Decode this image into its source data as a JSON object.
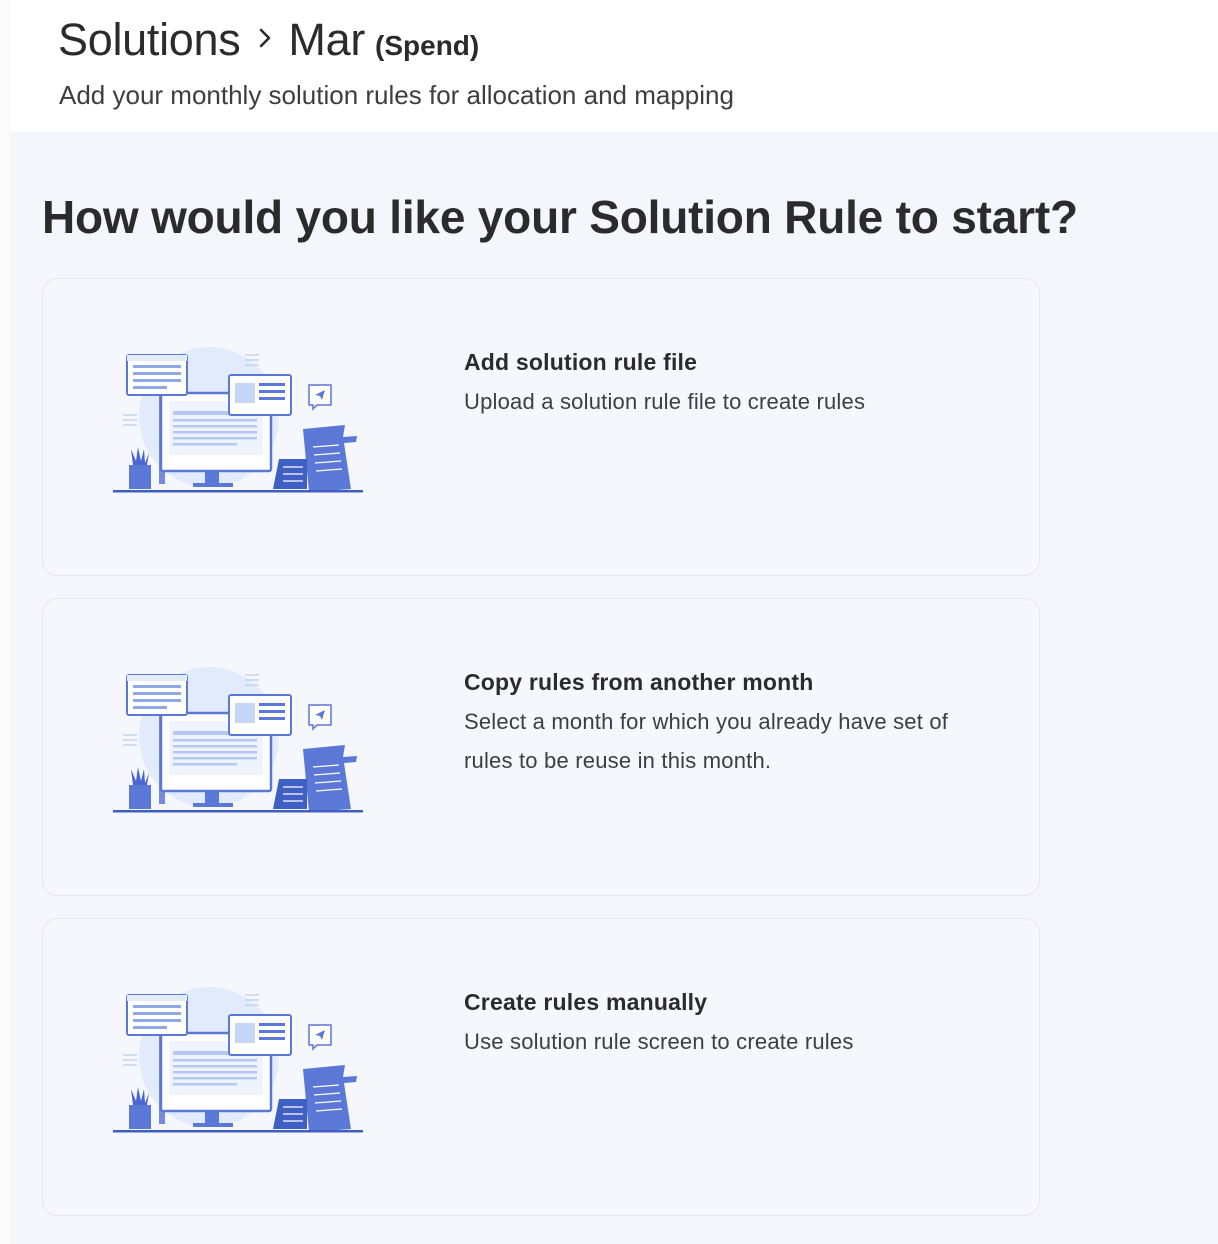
{
  "header": {
    "breadcrumb": {
      "root": "Solutions",
      "separator_icon": "chevron-right-icon",
      "current": "Mar",
      "tag": "(Spend)"
    },
    "subtitle": "Add your monthly solution rules for allocation and mapping"
  },
  "main": {
    "question": "How would you like your Solution Rule to start?",
    "options": [
      {
        "title": "Add solution rule file",
        "description": "Upload a solution rule file to create rules",
        "illustration": "desktop-workspace-illustration"
      },
      {
        "title": "Copy rules from another month",
        "description": "Select a month for which you already have set of rules to be reuse in this month.",
        "illustration": "desktop-workspace-illustration"
      },
      {
        "title": "Create rules manually",
        "description": "Use solution rule screen to create rules",
        "illustration": "desktop-workspace-illustration"
      }
    ]
  },
  "colors": {
    "page_background": "#f4f6fb",
    "illustration_primary": "#5b78d6",
    "illustration_light": "#e2ebfb",
    "text_primary": "#2b2b2e"
  }
}
